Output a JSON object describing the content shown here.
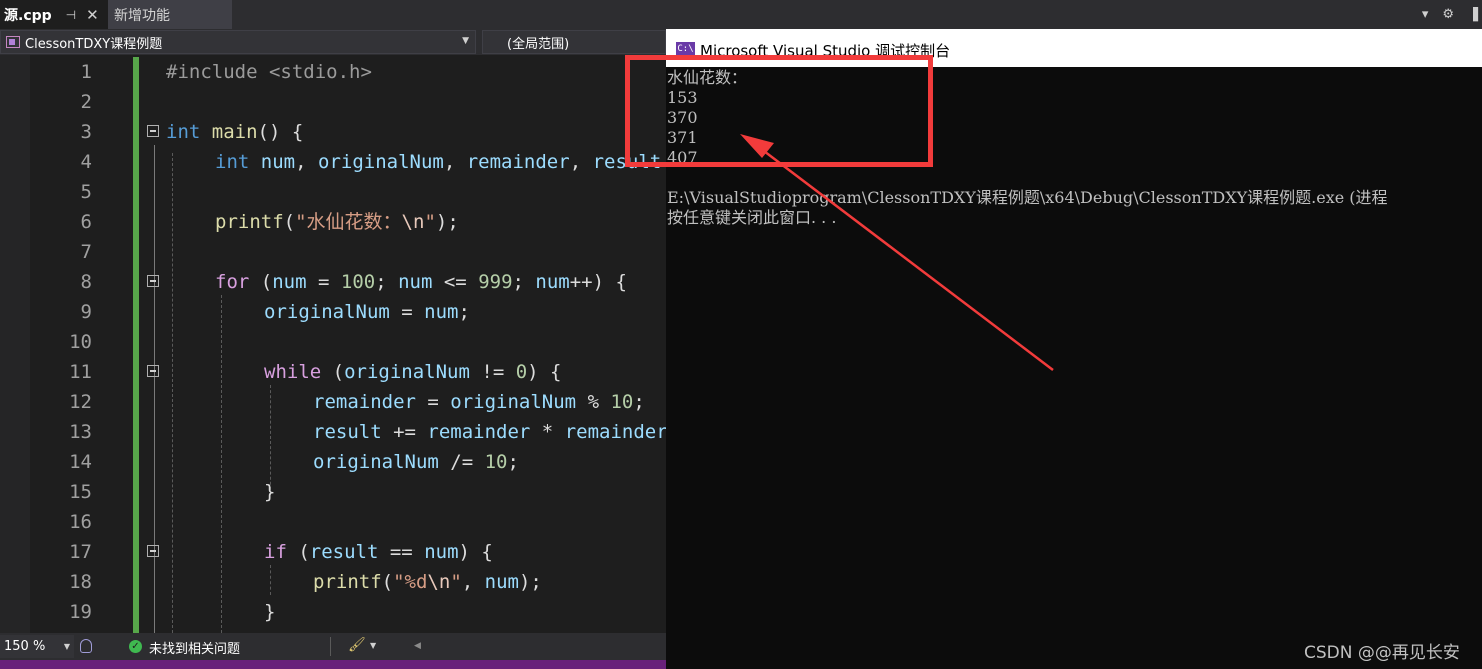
{
  "tabs": [
    {
      "label": "源.cpp",
      "active": true
    },
    {
      "label": "新增功能",
      "active": false
    }
  ],
  "navbar": {
    "project": "ClessonTDXY课程例题",
    "scope": "(全局范围)"
  },
  "editor": {
    "lines": [
      {
        "n": "1"
      },
      {
        "n": "2"
      },
      {
        "n": "3"
      },
      {
        "n": "4"
      },
      {
        "n": "5"
      },
      {
        "n": "6"
      },
      {
        "n": "7"
      },
      {
        "n": "8"
      },
      {
        "n": "9"
      },
      {
        "n": "10"
      },
      {
        "n": "11"
      },
      {
        "n": "12"
      },
      {
        "n": "13"
      },
      {
        "n": "14"
      },
      {
        "n": "15"
      },
      {
        "n": "16"
      },
      {
        "n": "17"
      },
      {
        "n": "18"
      },
      {
        "n": "19"
      }
    ]
  },
  "statusbar": {
    "zoom": "150 %",
    "issues": "未找到相关问题"
  },
  "console": {
    "title": "Microsoft Visual Studio 调试控制台",
    "icon_text": "C:\\",
    "heading": "水仙花数：",
    "results": [
      "153",
      "370",
      "371",
      "407"
    ],
    "exit_line": "E:\\VisualStudioprogram\\ClessonTDXY课程例题\\x64\\Debug\\ClessonTDXY课程例题.exe (进程",
    "close_prompt": "按任意键关闭此窗口. . ."
  },
  "watermark": "CSDN @@再见长安",
  "colors": {
    "annotation": "#f23b3b",
    "keyword": "#569cd6",
    "control": "#d8a0df",
    "string": "#d69d85",
    "number": "#b5cea8",
    "variable": "#9cdcfe",
    "function": "#dcdcaa",
    "changebar": "#57a64a"
  }
}
